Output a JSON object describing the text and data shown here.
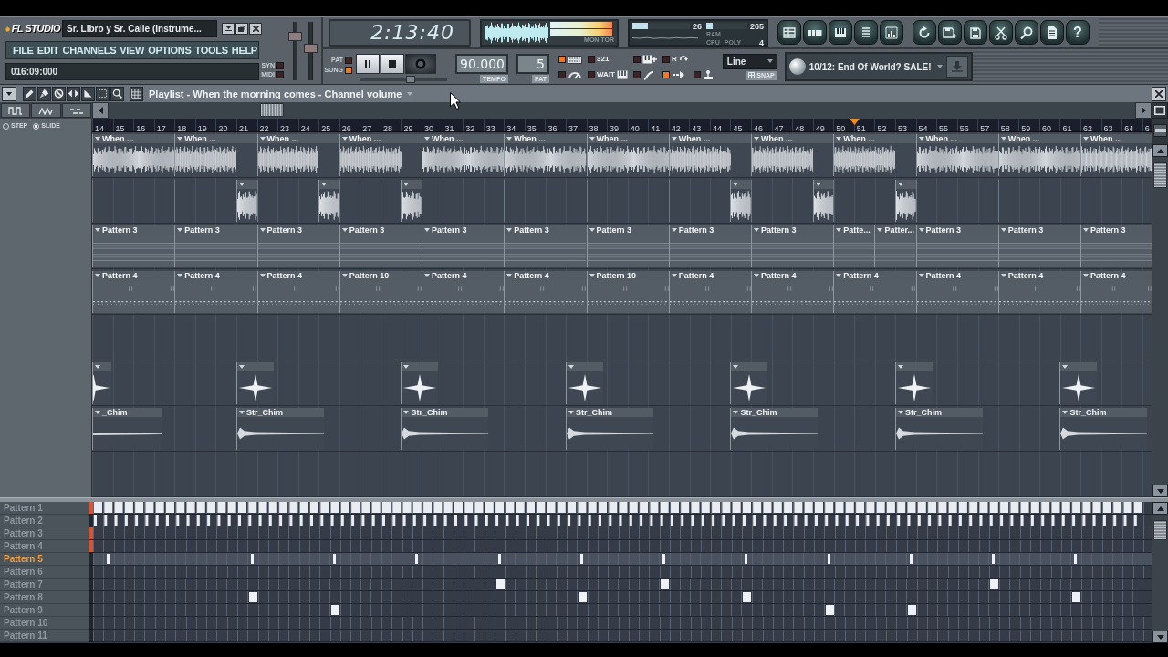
{
  "app": {
    "logo": "FL STUDIO",
    "title": "Sr. Libro y Sr. Calle (Instrume...",
    "menu": [
      "FILE",
      "EDIT",
      "CHANNELS",
      "VIEW",
      "OPTIONS",
      "TOOLS",
      "HELP"
    ],
    "hint": "016:09:000"
  },
  "midi_sync": [
    {
      "label": "SYN",
      "on": false
    },
    {
      "label": "MIDI",
      "on": false
    }
  ],
  "master_sliders": [
    {
      "level": 0.8
    },
    {
      "level": 0.55
    }
  ],
  "time_display": {
    "time": "2:13:40"
  },
  "monitor": {
    "vu": [
      {
        "level": 0.97
      },
      {
        "level": 0.97
      }
    ],
    "label": "MONITOR"
  },
  "cpu_panel": {
    "meters": [
      {
        "reading": "26",
        "level": 0.27
      },
      {
        "reading": "265",
        "level": 0.16
      }
    ],
    "labels": [
      "RAM",
      "CPU",
      "POLY"
    ],
    "poly": "4"
  },
  "window_shortcuts": [
    {
      "kind": "playlist"
    },
    {
      "kind": "steps"
    },
    {
      "kind": "piano"
    },
    {
      "kind": "browser"
    },
    {
      "kind": "mixer"
    }
  ],
  "file_tools": [
    {
      "kind": "undo"
    },
    {
      "kind": "save_new"
    },
    {
      "kind": "save"
    },
    {
      "kind": "cut"
    },
    {
      "kind": "search"
    },
    {
      "kind": "document"
    },
    {
      "kind": "help",
      "label": "?"
    }
  ],
  "transport": {
    "modes": [
      {
        "label": "PAT",
        "selected": false
      },
      {
        "label": "SONG",
        "selected": true
      }
    ],
    "buttons": [
      {
        "kind": "pause"
      },
      {
        "kind": "stop"
      },
      {
        "kind": "record"
      }
    ],
    "position": {
      "level": 0.59
    },
    "tempo": {
      "value": "90.000",
      "label": "TEMPO"
    },
    "pattern": {
      "value": "5",
      "label": "PAT"
    }
  },
  "record_options": [
    {
      "kind": "keyboard",
      "on": true
    },
    {
      "kind": "dial",
      "on": false
    },
    {
      "kind": "countdown",
      "label": "321",
      "on": false
    },
    {
      "kind": "wait",
      "label": "WAIT",
      "on": false
    },
    {
      "kind": "piano",
      "on": false
    },
    {
      "kind": "curve",
      "on": false
    },
    {
      "kind": "loop",
      "label": "R",
      "on": false
    },
    {
      "kind": "arrows",
      "on": true
    },
    {
      "kind": "joystick",
      "on": false
    }
  ],
  "snap": {
    "value": "Line",
    "label": "SNAP"
  },
  "news": {
    "text": "10/12: End Of World? SALE!"
  },
  "playlist": {
    "title": "Playlist - When the morning comes - Channel volume",
    "tools": [
      {
        "kind": "pencil"
      },
      {
        "kind": "brush"
      },
      {
        "kind": "mute"
      },
      {
        "kind": "slip"
      },
      {
        "kind": "slice"
      },
      {
        "kind": "select"
      },
      {
        "kind": "zoom"
      },
      {
        "kind": "snap"
      }
    ],
    "view_modes": [
      {
        "kind": "square"
      },
      {
        "kind": "triangle"
      },
      {
        "kind": "dashed"
      }
    ],
    "slide_mode": [
      {
        "label": "STEP",
        "selected": false
      },
      {
        "label": "SLIDE",
        "selected": true
      }
    ],
    "ruler": [
      {
        "label": "14",
        "playhead": false
      },
      {
        "label": "15",
        "playhead": false
      },
      {
        "label": "16",
        "playhead": false
      },
      {
        "label": "17",
        "playhead": false
      },
      {
        "label": "18",
        "playhead": false
      },
      {
        "label": "19",
        "playhead": false
      },
      {
        "label": "20",
        "playhead": false
      },
      {
        "label": "21",
        "playhead": false
      },
      {
        "label": "22",
        "playhead": false
      },
      {
        "label": "23",
        "playhead": false
      },
      {
        "label": "24",
        "playhead": false
      },
      {
        "label": "25",
        "playhead": false
      },
      {
        "label": "26",
        "playhead": false
      },
      {
        "label": "27",
        "playhead": false
      },
      {
        "label": "28",
        "playhead": false
      },
      {
        "label": "29",
        "playhead": false
      },
      {
        "label": "30",
        "playhead": false
      },
      {
        "label": "31",
        "playhead": false
      },
      {
        "label": "32",
        "playhead": false
      },
      {
        "label": "33",
        "playhead": false
      },
      {
        "label": "34",
        "playhead": false
      },
      {
        "label": "35",
        "playhead": false
      },
      {
        "label": "36",
        "playhead": false
      },
      {
        "label": "37",
        "playhead": false
      },
      {
        "label": "38",
        "playhead": false
      },
      {
        "label": "39",
        "playhead": false
      },
      {
        "label": "40",
        "playhead": false
      },
      {
        "label": "41",
        "playhead": false
      },
      {
        "label": "42",
        "playhead": false
      },
      {
        "label": "43",
        "playhead": false
      },
      {
        "label": "44",
        "playhead": false
      },
      {
        "label": "45",
        "playhead": false
      },
      {
        "label": "46",
        "playhead": false
      },
      {
        "label": "47",
        "playhead": false
      },
      {
        "label": "48",
        "playhead": false
      },
      {
        "label": "49",
        "playhead": false
      },
      {
        "label": "50",
        "playhead": false
      },
      {
        "label": "51",
        "playhead": true
      },
      {
        "label": "52",
        "playhead": false
      },
      {
        "label": "53",
        "playhead": false
      },
      {
        "label": "54",
        "playhead": false
      },
      {
        "label": "55",
        "playhead": false
      },
      {
        "label": "56",
        "playhead": false
      },
      {
        "label": "57",
        "playhead": false
      },
      {
        "label": "58",
        "playhead": false
      },
      {
        "label": "59",
        "playhead": false
      },
      {
        "label": "60",
        "playhead": false
      },
      {
        "label": "61",
        "playhead": false
      },
      {
        "label": "62",
        "playhead": false
      },
      {
        "label": "63",
        "playhead": false
      },
      {
        "label": "64",
        "playhead": false
      },
      {
        "label": "6",
        "playhead": false
      }
    ],
    "tracks": [
      {
        "kind": "audio",
        "clips": [
          {
            "label": "When ...",
            "silent_end": false
          },
          {
            "label": "When ...",
            "silent_end": true
          },
          {
            "label": "When ...",
            "silent_end": true
          },
          {
            "label": "When ...",
            "silent_end": true
          },
          {
            "label": "When ...",
            "silent_end": false
          },
          {
            "label": "When ...",
            "silent_end": false
          },
          {
            "label": "When ...",
            "silent_end": false
          },
          {
            "label": "When ...",
            "silent_end": true
          },
          {
            "label": "When ...",
            "silent_end": true
          },
          {
            "label": "When ...",
            "silent_end": true
          },
          {
            "label": "When ...",
            "silent_end": false
          },
          {
            "label": "When ...",
            "silent_end": false
          },
          {
            "label": "When ...",
            "silent_end": false
          }
        ]
      },
      {
        "kind": "slots",
        "slots": [
          {
            "filled": false
          },
          {
            "filled": true
          },
          {
            "filled": true
          },
          {
            "filled": true
          },
          {
            "filled": false
          },
          {
            "filled": false
          },
          {
            "filled": false
          },
          {
            "filled": true
          },
          {
            "filled": true
          },
          {
            "filled": true
          },
          {
            "filled": false
          },
          {
            "filled": false
          }
        ]
      },
      {
        "kind": "lines",
        "clips": [
          {
            "label": "Pattern 3",
            "kind": "full"
          },
          {
            "label": "Pattern 3",
            "kind": "full"
          },
          {
            "label": "Pattern 3",
            "kind": "full"
          },
          {
            "label": "Pattern 3",
            "kind": "full"
          },
          {
            "label": "Pattern 3",
            "kind": "full"
          },
          {
            "label": "Pattern 3",
            "kind": "full"
          },
          {
            "label": "Pattern 3",
            "kind": "full"
          },
          {
            "label": "Pattern 3",
            "kind": "full"
          },
          {
            "label": "Pattern 3",
            "kind": "full"
          },
          {
            "label": "Patte...",
            "kind": "half"
          },
          {
            "label": "Patter...",
            "kind": "half"
          },
          {
            "label": "Pattern 3",
            "kind": "full"
          },
          {
            "label": "Pattern 3",
            "kind": "full"
          },
          {
            "label": "Pattern 3",
            "kind": "full"
          }
        ]
      },
      {
        "kind": "dots",
        "clips": [
          {
            "label": "Pattern 4",
            "kind": "full"
          },
          {
            "label": "Pattern 4",
            "kind": "full"
          },
          {
            "label": "Pattern 4",
            "kind": "full"
          },
          {
            "label": "Pattern 10",
            "kind": "full"
          },
          {
            "label": "Pattern 4",
            "kind": "full"
          },
          {
            "label": "Pattern 4",
            "kind": "full"
          },
          {
            "label": "Pattern 10",
            "kind": "full"
          },
          {
            "label": "Pattern 4",
            "kind": "full"
          },
          {
            "label": "Pattern 4",
            "kind": "full"
          },
          {
            "label": "Pattern 4",
            "kind": "full"
          },
          {
            "label": "Pattern 4",
            "kind": "full"
          },
          {
            "label": "Pattern 4",
            "kind": "full"
          },
          {
            "label": "Pattern 4",
            "kind": "full"
          }
        ]
      },
      {
        "kind": "empty"
      },
      {
        "kind": "sparkle",
        "clips": [
          {
            "cut": true
          },
          {
            "cut": false
          },
          {
            "cut": false
          },
          {
            "cut": false
          },
          {
            "cut": false
          },
          {
            "cut": false
          },
          {
            "cut": false
          }
        ]
      },
      {
        "kind": "chime",
        "clips": [
          {
            "label": "_Chim",
            "cut": true
          },
          {
            "label": "Str_Chim",
            "cut": false
          },
          {
            "label": "Str_Chim",
            "cut": false
          },
          {
            "label": "Str_Chim",
            "cut": false
          },
          {
            "label": "Str_Chim",
            "cut": false
          },
          {
            "label": "Str_Chim",
            "cut": false
          },
          {
            "label": "Str_Chim",
            "cut": false
          }
        ]
      },
      {
        "kind": "empty"
      }
    ]
  },
  "patterns": [
    {
      "label": "Pattern 1",
      "selected": false,
      "marked": true,
      "kind": "dense"
    },
    {
      "label": "Pattern 2",
      "selected": false,
      "marked": false,
      "kind": "thin"
    },
    {
      "label": "Pattern 3",
      "selected": false,
      "marked": true,
      "kind": "empty"
    },
    {
      "label": "Pattern 4",
      "selected": false,
      "marked": true,
      "kind": "empty"
    },
    {
      "label": "Pattern 5",
      "selected": true,
      "marked": false,
      "kind": "ticks",
      "steps": [
        true,
        false,
        false,
        false,
        false,
        false,
        false,
        true,
        false,
        false,
        false,
        true,
        false,
        false,
        false,
        true,
        false,
        false,
        false,
        true,
        false,
        false,
        false,
        true,
        false,
        false,
        false,
        true,
        false,
        false,
        false,
        true,
        false,
        false,
        false,
        true,
        false,
        false,
        false,
        true,
        false,
        false,
        false,
        true,
        false,
        false,
        false,
        true,
        false,
        false,
        false
      ]
    },
    {
      "label": "Pattern 6",
      "selected": false,
      "marked": false,
      "kind": "empty"
    },
    {
      "label": "Pattern 7",
      "selected": false,
      "marked": false,
      "kind": "blocks",
      "steps": [
        false,
        false,
        false,
        false,
        false,
        false,
        false,
        false,
        false,
        false,
        false,
        false,
        false,
        false,
        false,
        false,
        false,
        false,
        false,
        true,
        false,
        false,
        false,
        false,
        false,
        false,
        false,
        true,
        false,
        false,
        false,
        false,
        false,
        false,
        false,
        false,
        false,
        false,
        false,
        false,
        false,
        false,
        false,
        true,
        false,
        false,
        false,
        false,
        false,
        false,
        false
      ]
    },
    {
      "label": "Pattern 8",
      "selected": false,
      "marked": false,
      "kind": "blocks",
      "steps": [
        false,
        false,
        false,
        false,
        false,
        false,
        false,
        true,
        false,
        false,
        false,
        false,
        false,
        false,
        false,
        false,
        false,
        false,
        false,
        false,
        false,
        false,
        false,
        true,
        false,
        false,
        false,
        false,
        false,
        false,
        false,
        true,
        false,
        false,
        false,
        false,
        false,
        false,
        false,
        false,
        false,
        false,
        false,
        false,
        false,
        false,
        false,
        true,
        false,
        false,
        false
      ]
    },
    {
      "label": "Pattern 9",
      "selected": false,
      "marked": false,
      "kind": "blocks",
      "steps": [
        false,
        false,
        false,
        false,
        false,
        false,
        false,
        false,
        false,
        false,
        false,
        true,
        false,
        false,
        false,
        false,
        false,
        false,
        false,
        false,
        false,
        false,
        false,
        false,
        false,
        false,
        false,
        false,
        false,
        false,
        false,
        false,
        false,
        false,
        false,
        true,
        false,
        false,
        false,
        true,
        false,
        false,
        false,
        false,
        false,
        false,
        false,
        false,
        false,
        false,
        false
      ]
    },
    {
      "label": "Pattern 10",
      "selected": false,
      "marked": false,
      "kind": "empty"
    },
    {
      "label": "Pattern 11",
      "selected": false,
      "marked": false,
      "kind": "empty"
    }
  ]
}
